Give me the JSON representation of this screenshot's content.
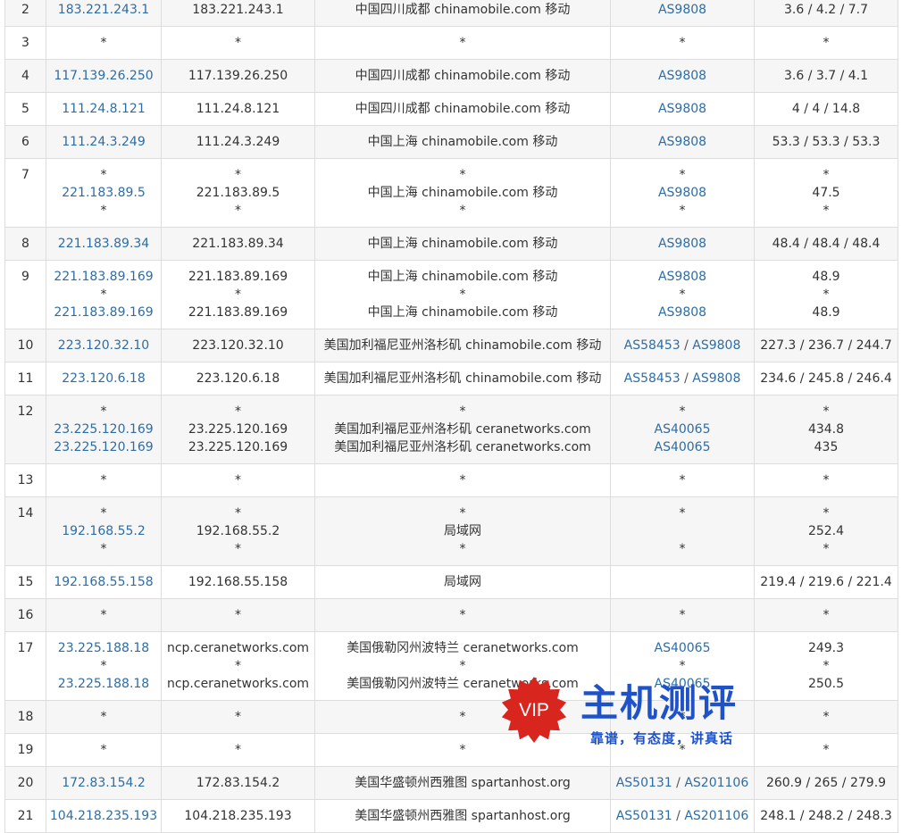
{
  "trace": {
    "rows": [
      {
        "hop": "2",
        "ip": [
          "183.221.243.1"
        ],
        "host": [
          "183.221.243.1"
        ],
        "loc": [
          "中国四川成都 chinamobile.com 移动"
        ],
        "as": [
          [
            "AS9808"
          ]
        ],
        "rtt": [
          "3.6 / 4.2 / 7.7"
        ]
      },
      {
        "hop": "3",
        "ip": [
          "*"
        ],
        "host": [
          "*"
        ],
        "loc": [
          "*"
        ],
        "as": [
          [
            "*"
          ]
        ],
        "rtt": [
          "*"
        ]
      },
      {
        "hop": "4",
        "ip": [
          "117.139.26.250"
        ],
        "host": [
          "117.139.26.250"
        ],
        "loc": [
          "中国四川成都 chinamobile.com 移动"
        ],
        "as": [
          [
            "AS9808"
          ]
        ],
        "rtt": [
          "3.6 / 3.7 / 4.1"
        ]
      },
      {
        "hop": "5",
        "ip": [
          "111.24.8.121"
        ],
        "host": [
          "111.24.8.121"
        ],
        "loc": [
          "中国四川成都 chinamobile.com 移动"
        ],
        "as": [
          [
            "AS9808"
          ]
        ],
        "rtt": [
          "4 / 4 / 14.8"
        ]
      },
      {
        "hop": "6",
        "ip": [
          "111.24.3.249"
        ],
        "host": [
          "111.24.3.249"
        ],
        "loc": [
          "中国上海 chinamobile.com 移动"
        ],
        "as": [
          [
            "AS9808"
          ]
        ],
        "rtt": [
          "53.3 / 53.3 / 53.3"
        ]
      },
      {
        "hop": "7",
        "ip": [
          "*",
          "221.183.89.5",
          "*"
        ],
        "host": [
          "*",
          "221.183.89.5",
          "*"
        ],
        "loc": [
          "*",
          "中国上海 chinamobile.com 移动",
          "*"
        ],
        "as": [
          [
            "*"
          ],
          [
            "AS9808"
          ],
          [
            "*"
          ]
        ],
        "rtt": [
          "*",
          "47.5",
          "*"
        ]
      },
      {
        "hop": "8",
        "ip": [
          "221.183.89.34"
        ],
        "host": [
          "221.183.89.34"
        ],
        "loc": [
          "中国上海 chinamobile.com 移动"
        ],
        "as": [
          [
            "AS9808"
          ]
        ],
        "rtt": [
          "48.4 / 48.4 / 48.4"
        ]
      },
      {
        "hop": "9",
        "ip": [
          "221.183.89.169",
          "*",
          "221.183.89.169"
        ],
        "host": [
          "221.183.89.169",
          "*",
          "221.183.89.169"
        ],
        "loc": [
          "中国上海 chinamobile.com 移动",
          "*",
          "中国上海 chinamobile.com 移动"
        ],
        "as": [
          [
            "AS9808"
          ],
          [
            "*"
          ],
          [
            "AS9808"
          ]
        ],
        "rtt": [
          "48.9",
          "*",
          "48.9"
        ]
      },
      {
        "hop": "10",
        "ip": [
          "223.120.32.10"
        ],
        "host": [
          "223.120.32.10"
        ],
        "loc": [
          "美国加利福尼亚州洛杉矶 chinamobile.com 移动"
        ],
        "as": [
          [
            "AS58453",
            "AS9808"
          ]
        ],
        "rtt": [
          "227.3 / 236.7 / 244.7"
        ]
      },
      {
        "hop": "11",
        "ip": [
          "223.120.6.18"
        ],
        "host": [
          "223.120.6.18"
        ],
        "loc": [
          "美国加利福尼亚州洛杉矶 chinamobile.com 移动"
        ],
        "as": [
          [
            "AS58453",
            "AS9808"
          ]
        ],
        "rtt": [
          "234.6 / 245.8 / 246.4"
        ]
      },
      {
        "hop": "12",
        "ip": [
          "*",
          "23.225.120.169",
          "23.225.120.169"
        ],
        "host": [
          "*",
          "23.225.120.169",
          "23.225.120.169"
        ],
        "loc": [
          "*",
          "美国加利福尼亚州洛杉矶 ceranetworks.com",
          "美国加利福尼亚州洛杉矶 ceranetworks.com"
        ],
        "as": [
          [
            "*"
          ],
          [
            "AS40065"
          ],
          [
            "AS40065"
          ]
        ],
        "rtt": [
          "*",
          "434.8",
          "435"
        ]
      },
      {
        "hop": "13",
        "ip": [
          "*"
        ],
        "host": [
          "*"
        ],
        "loc": [
          "*"
        ],
        "as": [
          [
            "*"
          ]
        ],
        "rtt": [
          "*"
        ]
      },
      {
        "hop": "14",
        "ip": [
          "*",
          "192.168.55.2",
          "*"
        ],
        "host": [
          "*",
          "192.168.55.2",
          "*"
        ],
        "loc": [
          "*",
          "局域网",
          "*"
        ],
        "as": [
          [
            "*"
          ],
          [],
          [
            "*"
          ]
        ],
        "rtt": [
          "*",
          "252.4",
          "*"
        ]
      },
      {
        "hop": "15",
        "ip": [
          "192.168.55.158"
        ],
        "host": [
          "192.168.55.158"
        ],
        "loc": [
          "局域网"
        ],
        "as": [
          []
        ],
        "rtt": [
          "219.4 / 219.6 / 221.4"
        ]
      },
      {
        "hop": "16",
        "ip": [
          "*"
        ],
        "host": [
          "*"
        ],
        "loc": [
          "*"
        ],
        "as": [
          [
            "*"
          ]
        ],
        "rtt": [
          "*"
        ]
      },
      {
        "hop": "17",
        "ip": [
          "23.225.188.18",
          "*",
          "23.225.188.18"
        ],
        "host": [
          "ncp.ceranetworks.com",
          "*",
          "ncp.ceranetworks.com"
        ],
        "loc": [
          "美国俄勒冈州波特兰 ceranetworks.com",
          "*",
          "美国俄勒冈州波特兰 ceranetworks.com"
        ],
        "as": [
          [
            "AS40065"
          ],
          [
            "*"
          ],
          [
            "AS40065"
          ]
        ],
        "rtt": [
          "249.3",
          "*",
          "250.5"
        ]
      },
      {
        "hop": "18",
        "ip": [
          "*"
        ],
        "host": [
          "*"
        ],
        "loc": [
          "*"
        ],
        "as": [
          [
            "*"
          ]
        ],
        "rtt": [
          "*"
        ]
      },
      {
        "hop": "19",
        "ip": [
          "*"
        ],
        "host": [
          "*"
        ],
        "loc": [
          "*"
        ],
        "as": [
          [
            "*"
          ]
        ],
        "rtt": [
          "*"
        ]
      },
      {
        "hop": "20",
        "ip": [
          "172.83.154.2"
        ],
        "host": [
          "172.83.154.2"
        ],
        "loc": [
          "美国华盛顿州西雅图 spartanhost.org"
        ],
        "as": [
          [
            "AS50131",
            "AS201106"
          ]
        ],
        "rtt": [
          "260.9 / 265 / 279.9"
        ]
      },
      {
        "hop": "21",
        "ip": [
          "104.218.235.193"
        ],
        "host": [
          "104.218.235.193"
        ],
        "loc": [
          "美国华盛顿州西雅图 spartanhost.org"
        ],
        "as": [
          [
            "AS50131",
            "AS201106"
          ]
        ],
        "rtt": [
          "248.1 / 248.2 / 248.3"
        ]
      }
    ]
  },
  "watermark": {
    "badge": "VIP",
    "title": "主机测评",
    "slogan": "靠谱，有态度，讲真话",
    "colors": {
      "seal": "#d8261f",
      "text": "#1f52c9"
    }
  },
  "colors": {
    "link": "#2e6da4",
    "row_alt": "#f6f6f6",
    "border": "#dddddd",
    "text": "#333333"
  }
}
